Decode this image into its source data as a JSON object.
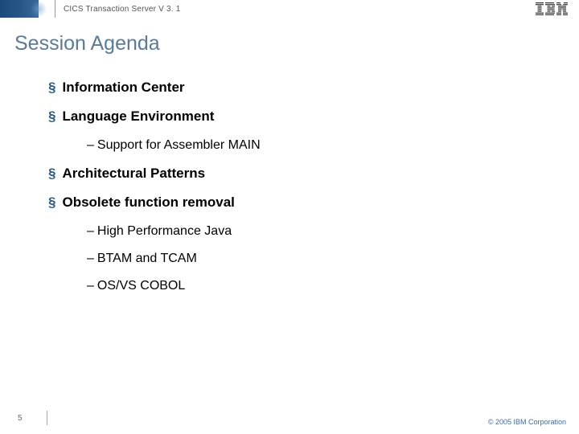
{
  "header": {
    "product": "CICS Transaction Server V 3. 1",
    "logo_label": "IBM"
  },
  "title": "Session Agenda",
  "bullets": [
    {
      "text": "Information Center",
      "subs": []
    },
    {
      "text": "Language Environment",
      "subs": [
        "Support for Assembler MAIN"
      ]
    },
    {
      "text": "Architectural Patterns",
      "subs": []
    },
    {
      "text": "Obsolete function removal",
      "subs": [
        "High Performance Java",
        "BTAM and TCAM",
        "OS/VS COBOL"
      ]
    }
  ],
  "footer": {
    "page": "5",
    "copyright": "© 2005 IBM Corporation"
  }
}
